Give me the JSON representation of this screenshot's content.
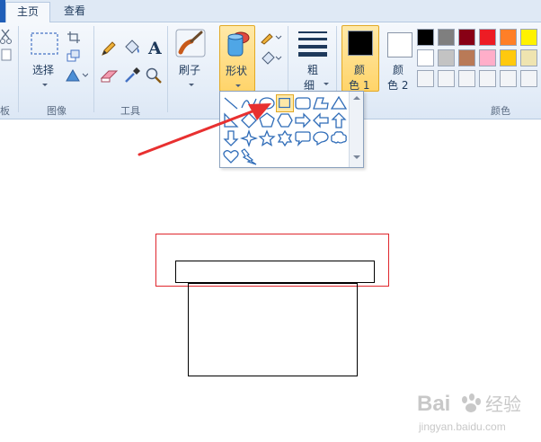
{
  "tabs": {
    "home": "主页",
    "view": "查看"
  },
  "ribbon": {
    "select_label": "选择",
    "brush_label": "刷子",
    "shapes_label": "形状",
    "size_label_line1": "粗",
    "size_label_line2": "细",
    "color1_line1": "颜",
    "color1_line2": "色 1",
    "color2_line1": "颜",
    "color2_line2": "色 2",
    "groups": {
      "clipboard": "板",
      "image": "图像",
      "tools": "工具",
      "colors": "颜色"
    }
  },
  "colors": {
    "accent": "#e3a925",
    "color1": "#000000",
    "color2": "#ffffff",
    "palette_row1": [
      "#000000",
      "#7f7f7f",
      "#880015",
      "#ed1c24",
      "#ff7f27",
      "#fff200"
    ],
    "palette_row2": [
      "#ffffff",
      "#c3c3c3",
      "#b97a57",
      "#ffaec9",
      "#ffc90e",
      "#efe4b0"
    ]
  },
  "shape_gallery": {
    "selected": "rectangle",
    "shapes": [
      "line",
      "curve",
      "oval",
      "rectangle",
      "rounded-rectangle",
      "polygon",
      "triangle",
      "right-triangle",
      "diamond",
      "pentagon",
      "hexagon",
      "right-arrow",
      "left-arrow",
      "up-arrow",
      "down-arrow",
      "four-point-star",
      "five-point-star",
      "six-point-star",
      "rounded-callout",
      "oval-callout",
      "cloud-callout",
      "heart",
      "lightning"
    ]
  },
  "watermark": {
    "line1": "Bai",
    "line2": "经验",
    "url": "jingyan.baidu.com"
  }
}
